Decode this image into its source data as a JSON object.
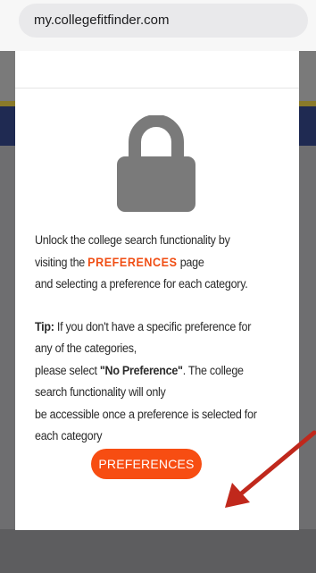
{
  "browser": {
    "url": "my.collegefitfinder.com"
  },
  "modal": {
    "line1": "Unlock the college search functionality by",
    "line2_prefix": "visiting the ",
    "line2_link": "PREFERENCES",
    "line2_suffix": " page",
    "line3": "and selecting a preference for each category.",
    "tip_label": "Tip:",
    "tip_line1": " If you don't have a specific preference for",
    "tip_line2": "any of the categories,",
    "tip_line3_prefix": "please select ",
    "tip_line3_bold": "\"No Preference\"",
    "tip_line3_suffix": ". The college",
    "tip_line4": "search functionality will only",
    "tip_line5": "be accessible once a preference is selected for",
    "tip_line6": "each category",
    "button_label": "PREFERENCES"
  },
  "icons": {
    "lock": "lock-icon",
    "arrow": "red-arrow-annotation"
  },
  "colors": {
    "accent": "#f74d12",
    "lock": "#7a7a7a",
    "arrow": "#c0281c",
    "overlay": "#6c6c6c"
  }
}
